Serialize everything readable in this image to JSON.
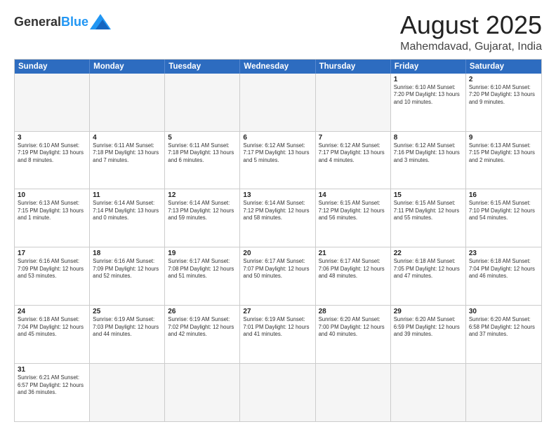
{
  "header": {
    "logo_general": "General",
    "logo_blue": "Blue",
    "month_title": "August 2025",
    "location": "Mahemdavad, Gujarat, India"
  },
  "calendar": {
    "weekdays": [
      "Sunday",
      "Monday",
      "Tuesday",
      "Wednesday",
      "Thursday",
      "Friday",
      "Saturday"
    ],
    "weeks": [
      [
        {
          "day": "",
          "info": "",
          "empty": true
        },
        {
          "day": "",
          "info": "",
          "empty": true
        },
        {
          "day": "",
          "info": "",
          "empty": true
        },
        {
          "day": "",
          "info": "",
          "empty": true
        },
        {
          "day": "",
          "info": "",
          "empty": true
        },
        {
          "day": "1",
          "info": "Sunrise: 6:10 AM\nSunset: 7:20 PM\nDaylight: 13 hours\nand 10 minutes."
        },
        {
          "day": "2",
          "info": "Sunrise: 6:10 AM\nSunset: 7:20 PM\nDaylight: 13 hours\nand 9 minutes."
        }
      ],
      [
        {
          "day": "3",
          "info": "Sunrise: 6:10 AM\nSunset: 7:19 PM\nDaylight: 13 hours\nand 8 minutes."
        },
        {
          "day": "4",
          "info": "Sunrise: 6:11 AM\nSunset: 7:18 PM\nDaylight: 13 hours\nand 7 minutes."
        },
        {
          "day": "5",
          "info": "Sunrise: 6:11 AM\nSunset: 7:18 PM\nDaylight: 13 hours\nand 6 minutes."
        },
        {
          "day": "6",
          "info": "Sunrise: 6:12 AM\nSunset: 7:17 PM\nDaylight: 13 hours\nand 5 minutes."
        },
        {
          "day": "7",
          "info": "Sunrise: 6:12 AM\nSunset: 7:17 PM\nDaylight: 13 hours\nand 4 minutes."
        },
        {
          "day": "8",
          "info": "Sunrise: 6:12 AM\nSunset: 7:16 PM\nDaylight: 13 hours\nand 3 minutes."
        },
        {
          "day": "9",
          "info": "Sunrise: 6:13 AM\nSunset: 7:15 PM\nDaylight: 13 hours\nand 2 minutes."
        }
      ],
      [
        {
          "day": "10",
          "info": "Sunrise: 6:13 AM\nSunset: 7:15 PM\nDaylight: 13 hours\nand 1 minute."
        },
        {
          "day": "11",
          "info": "Sunrise: 6:14 AM\nSunset: 7:14 PM\nDaylight: 13 hours\nand 0 minutes."
        },
        {
          "day": "12",
          "info": "Sunrise: 6:14 AM\nSunset: 7:13 PM\nDaylight: 12 hours\nand 59 minutes."
        },
        {
          "day": "13",
          "info": "Sunrise: 6:14 AM\nSunset: 7:12 PM\nDaylight: 12 hours\nand 58 minutes."
        },
        {
          "day": "14",
          "info": "Sunrise: 6:15 AM\nSunset: 7:12 PM\nDaylight: 12 hours\nand 56 minutes."
        },
        {
          "day": "15",
          "info": "Sunrise: 6:15 AM\nSunset: 7:11 PM\nDaylight: 12 hours\nand 55 minutes."
        },
        {
          "day": "16",
          "info": "Sunrise: 6:15 AM\nSunset: 7:10 PM\nDaylight: 12 hours\nand 54 minutes."
        }
      ],
      [
        {
          "day": "17",
          "info": "Sunrise: 6:16 AM\nSunset: 7:09 PM\nDaylight: 12 hours\nand 53 minutes."
        },
        {
          "day": "18",
          "info": "Sunrise: 6:16 AM\nSunset: 7:09 PM\nDaylight: 12 hours\nand 52 minutes."
        },
        {
          "day": "19",
          "info": "Sunrise: 6:17 AM\nSunset: 7:08 PM\nDaylight: 12 hours\nand 51 minutes."
        },
        {
          "day": "20",
          "info": "Sunrise: 6:17 AM\nSunset: 7:07 PM\nDaylight: 12 hours\nand 50 minutes."
        },
        {
          "day": "21",
          "info": "Sunrise: 6:17 AM\nSunset: 7:06 PM\nDaylight: 12 hours\nand 48 minutes."
        },
        {
          "day": "22",
          "info": "Sunrise: 6:18 AM\nSunset: 7:05 PM\nDaylight: 12 hours\nand 47 minutes."
        },
        {
          "day": "23",
          "info": "Sunrise: 6:18 AM\nSunset: 7:04 PM\nDaylight: 12 hours\nand 46 minutes."
        }
      ],
      [
        {
          "day": "24",
          "info": "Sunrise: 6:18 AM\nSunset: 7:04 PM\nDaylight: 12 hours\nand 45 minutes."
        },
        {
          "day": "25",
          "info": "Sunrise: 6:19 AM\nSunset: 7:03 PM\nDaylight: 12 hours\nand 44 minutes."
        },
        {
          "day": "26",
          "info": "Sunrise: 6:19 AM\nSunset: 7:02 PM\nDaylight: 12 hours\nand 42 minutes."
        },
        {
          "day": "27",
          "info": "Sunrise: 6:19 AM\nSunset: 7:01 PM\nDaylight: 12 hours\nand 41 minutes."
        },
        {
          "day": "28",
          "info": "Sunrise: 6:20 AM\nSunset: 7:00 PM\nDaylight: 12 hours\nand 40 minutes."
        },
        {
          "day": "29",
          "info": "Sunrise: 6:20 AM\nSunset: 6:59 PM\nDaylight: 12 hours\nand 39 minutes."
        },
        {
          "day": "30",
          "info": "Sunrise: 6:20 AM\nSunset: 6:58 PM\nDaylight: 12 hours\nand 37 minutes."
        }
      ],
      [
        {
          "day": "31",
          "info": "Sunrise: 6:21 AM\nSunset: 6:57 PM\nDaylight: 12 hours\nand 36 minutes."
        },
        {
          "day": "",
          "info": "",
          "empty": true
        },
        {
          "day": "",
          "info": "",
          "empty": true
        },
        {
          "day": "",
          "info": "",
          "empty": true
        },
        {
          "day": "",
          "info": "",
          "empty": true
        },
        {
          "day": "",
          "info": "",
          "empty": true
        },
        {
          "day": "",
          "info": "",
          "empty": true
        }
      ]
    ]
  }
}
